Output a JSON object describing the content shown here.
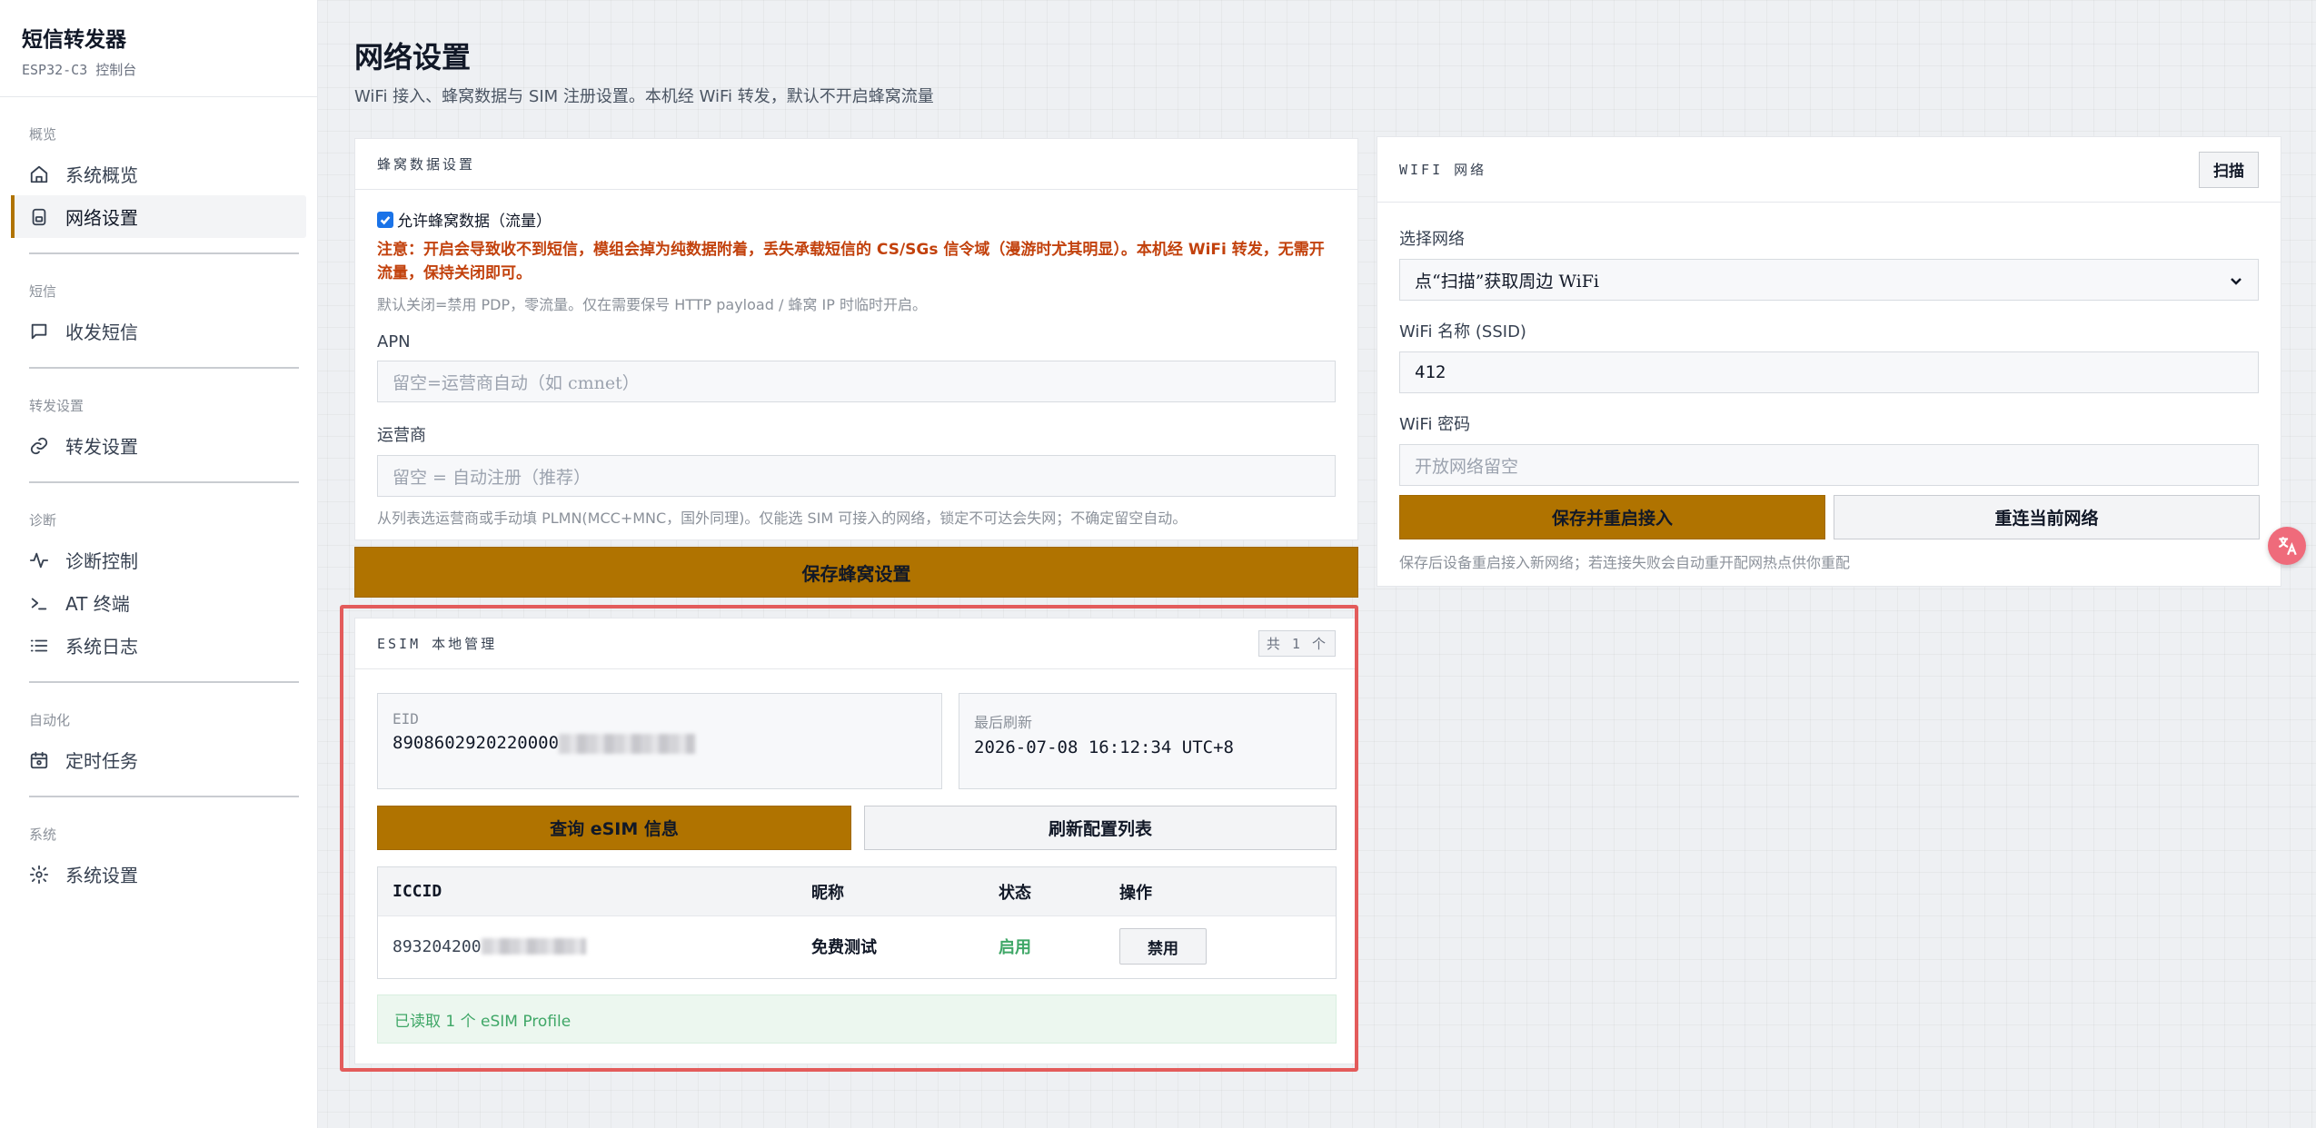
{
  "brand": {
    "title": "短信转发器",
    "subtitle": "ESP32-C3 控制台"
  },
  "sidebar": {
    "groups": [
      {
        "label": "概览",
        "items": [
          {
            "label": "系统概览",
            "icon": "home-icon"
          },
          {
            "label": "网络设置",
            "icon": "network-settings-icon",
            "active": true
          }
        ]
      },
      {
        "label": "短信",
        "items": [
          {
            "label": "收发短信",
            "icon": "message-icon"
          }
        ]
      },
      {
        "label": "转发设置",
        "items": [
          {
            "label": "转发设置",
            "icon": "link-icon"
          }
        ]
      },
      {
        "label": "诊断",
        "items": [
          {
            "label": "诊断控制",
            "icon": "activity-icon"
          },
          {
            "label": "AT 终端",
            "icon": "terminal-icon"
          },
          {
            "label": "系统日志",
            "icon": "list-icon"
          }
        ]
      },
      {
        "label": "自动化",
        "items": [
          {
            "label": "定时任务",
            "icon": "calendar-icon"
          }
        ]
      },
      {
        "label": "系统",
        "items": [
          {
            "label": "系统设置",
            "icon": "gear-icon"
          }
        ]
      }
    ]
  },
  "page": {
    "title": "网络设置",
    "description": "WiFi 接入、蜂窝数据与 SIM 注册设置。本机经 WiFi 转发，默认不开启蜂窝流量"
  },
  "cellular": {
    "title": "蜂窝数据设置",
    "allow_data_label": "允许蜂窝数据（流量）",
    "allow_data_checked": true,
    "warning": "注意：开启会导致收不到短信，模组会掉为纯数据附着，丢失承载短信的 CS/SGs 信令域（漫游时尤其明显）。本机经 WiFi 转发，无需开流量，保持关闭即可。",
    "default_hint": "默认关闭=禁用 PDP，零流量。仅在需要保号 HTTP payload / 蜂窝 IP 时临时开启。",
    "apn_label": "APN",
    "apn_placeholder": "留空=运营商自动（如 cmnet）",
    "operator_label": "运营商",
    "operator_placeholder": "留空 = 自动注册（推荐）",
    "operator_hint": "从列表选运营商或手动填 PLMN(MCC+MNC，国外同理)。仅能选 SIM 可接入的网络，锁定不可达会失网；不确定留空自动。",
    "save_label": "保存蜂窝设置"
  },
  "esim": {
    "title": "ESIM 本地管理",
    "count": "共 1 个",
    "eid_label": "EID",
    "eid_value": "8908602920220000",
    "refresh_label": "最后刷新",
    "refresh_value": "2026-07-08 16:12:34 UTC+8",
    "query_button": "查询 eSIM 信息",
    "refresh_button": "刷新配置列表",
    "table": {
      "headers": [
        "ICCID",
        "昵称",
        "状态",
        "操作"
      ],
      "rows": [
        {
          "iccid": "893204200",
          "nickname": "免费测试",
          "status": "启用",
          "action": "禁用"
        }
      ]
    },
    "success_message": "已读取 1 个 eSIM Profile"
  },
  "wifi": {
    "title": "WIFI 网络",
    "scan_button": "扫描",
    "select_label": "选择网络",
    "select_value": "点“扫描”获取周边 WiFi",
    "ssid_label": "WiFi 名称 (SSID)",
    "ssid_value": "412",
    "password_label": "WiFi 密码",
    "password_placeholder": "开放网络留空",
    "save_button": "保存并重启接入",
    "reconnect_button": "重连当前网络",
    "hint": "保存后设备重启接入新网络；若连接失败会自动重开配网热点供你重配"
  },
  "colors": {
    "accent": "#b07300",
    "warning": "#c2410c",
    "success": "#3fa767",
    "highlight": "#e35b5b"
  }
}
